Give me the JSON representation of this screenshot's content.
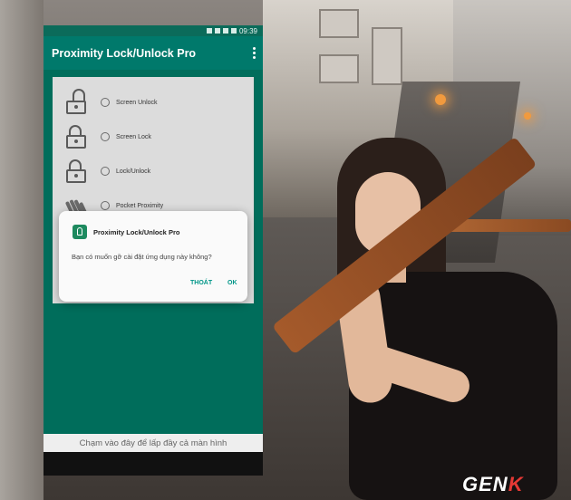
{
  "statusbar": {
    "time": "09:39"
  },
  "app": {
    "title": "Proximity Lock/Unlock Pro"
  },
  "options": [
    {
      "label": "Screen Unlock",
      "icon": "unlocked-padlock-icon"
    },
    {
      "label": "Screen Lock",
      "icon": "padlock-icon"
    },
    {
      "label": "Lock/Unlock",
      "icon": "padlock-icon"
    },
    {
      "label": "Pocket Proximity",
      "icon": "hand-wave-icon"
    }
  ],
  "dialog": {
    "title": "Proximity Lock/Unlock Pro",
    "message": "Bạn có muốn gỡ cài đặt ứng dụng này không?",
    "exit_label": "THOÁT",
    "ok_label": "OK"
  },
  "toast": "Chạm vào đây để lấp đầy cả màn hình",
  "brand": {
    "genk_main": "GEN",
    "genk_k": "K",
    "genk_accent": "#e53935"
  },
  "colors": {
    "appbar": "#00796b",
    "accent": "#009688"
  }
}
